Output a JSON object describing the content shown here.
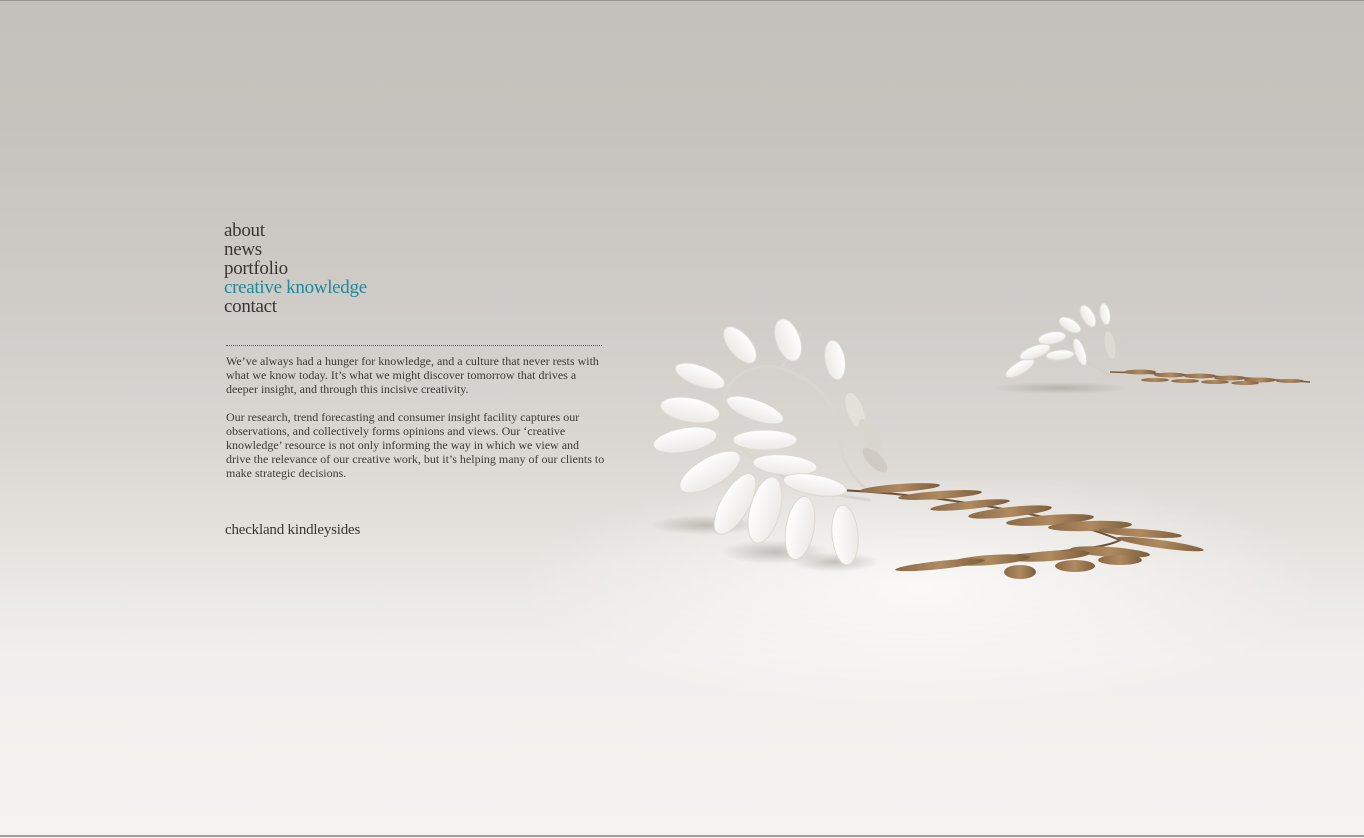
{
  "nav": {
    "items": [
      {
        "label": "about",
        "active": false
      },
      {
        "label": "news",
        "active": false
      },
      {
        "label": "portfolio",
        "active": false
      },
      {
        "label": "creative knowledge",
        "active": true
      },
      {
        "label": "contact",
        "active": false
      }
    ]
  },
  "content": {
    "paragraphs": [
      "We’ve always had a hunger for knowledge, and a culture that never rests with what we know today.  It’s what we might discover tomorrow that drives a deeper insight, and through this incisive creativity.",
      "Our research, trend forecasting and consumer insight facility captures our observations, and collectively forms opinions and views.  Our ‘creative knowledge’ resource is not only informing the way in which we view and drive the relevance of our creative work, but it’s helping many of our clients to make strategic decisions."
    ]
  },
  "footer": {
    "company": "checkland kindleysides"
  },
  "colors": {
    "nav_text": "#3a3530",
    "nav_active": "#1e8a9a",
    "body_text": "#3e3933"
  },
  "icons": {
    "artwork": "paper-cut-leaf-fronds-illustration"
  }
}
